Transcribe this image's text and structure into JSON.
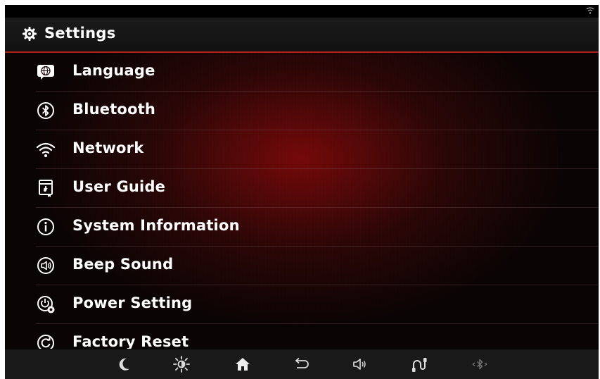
{
  "header": {
    "title": "Settings",
    "icon": "gear-icon"
  },
  "menu": {
    "items": [
      {
        "label": "Language",
        "icon": "globe-chat-icon"
      },
      {
        "label": "Bluetooth",
        "icon": "bluetooth-icon"
      },
      {
        "label": "Network",
        "icon": "wifi-icon"
      },
      {
        "label": "User Guide",
        "icon": "user-guide-icon"
      },
      {
        "label": "System Information",
        "icon": "info-icon"
      },
      {
        "label": "Beep Sound",
        "icon": "speaker-icon"
      },
      {
        "label": "Power Setting",
        "icon": "power-setting-icon"
      },
      {
        "label": "Factory Reset",
        "icon": "reset-icon"
      }
    ]
  },
  "bottom_bar": {
    "buttons": [
      "moon-icon",
      "brightness-icon",
      "home-icon",
      "back-icon",
      "volume-icon",
      "phone-projection-icon",
      "bluetooth-disabled-icon"
    ]
  },
  "colors": {
    "accent": "#b0231d",
    "background": "#120707",
    "text": "#ffffff"
  }
}
